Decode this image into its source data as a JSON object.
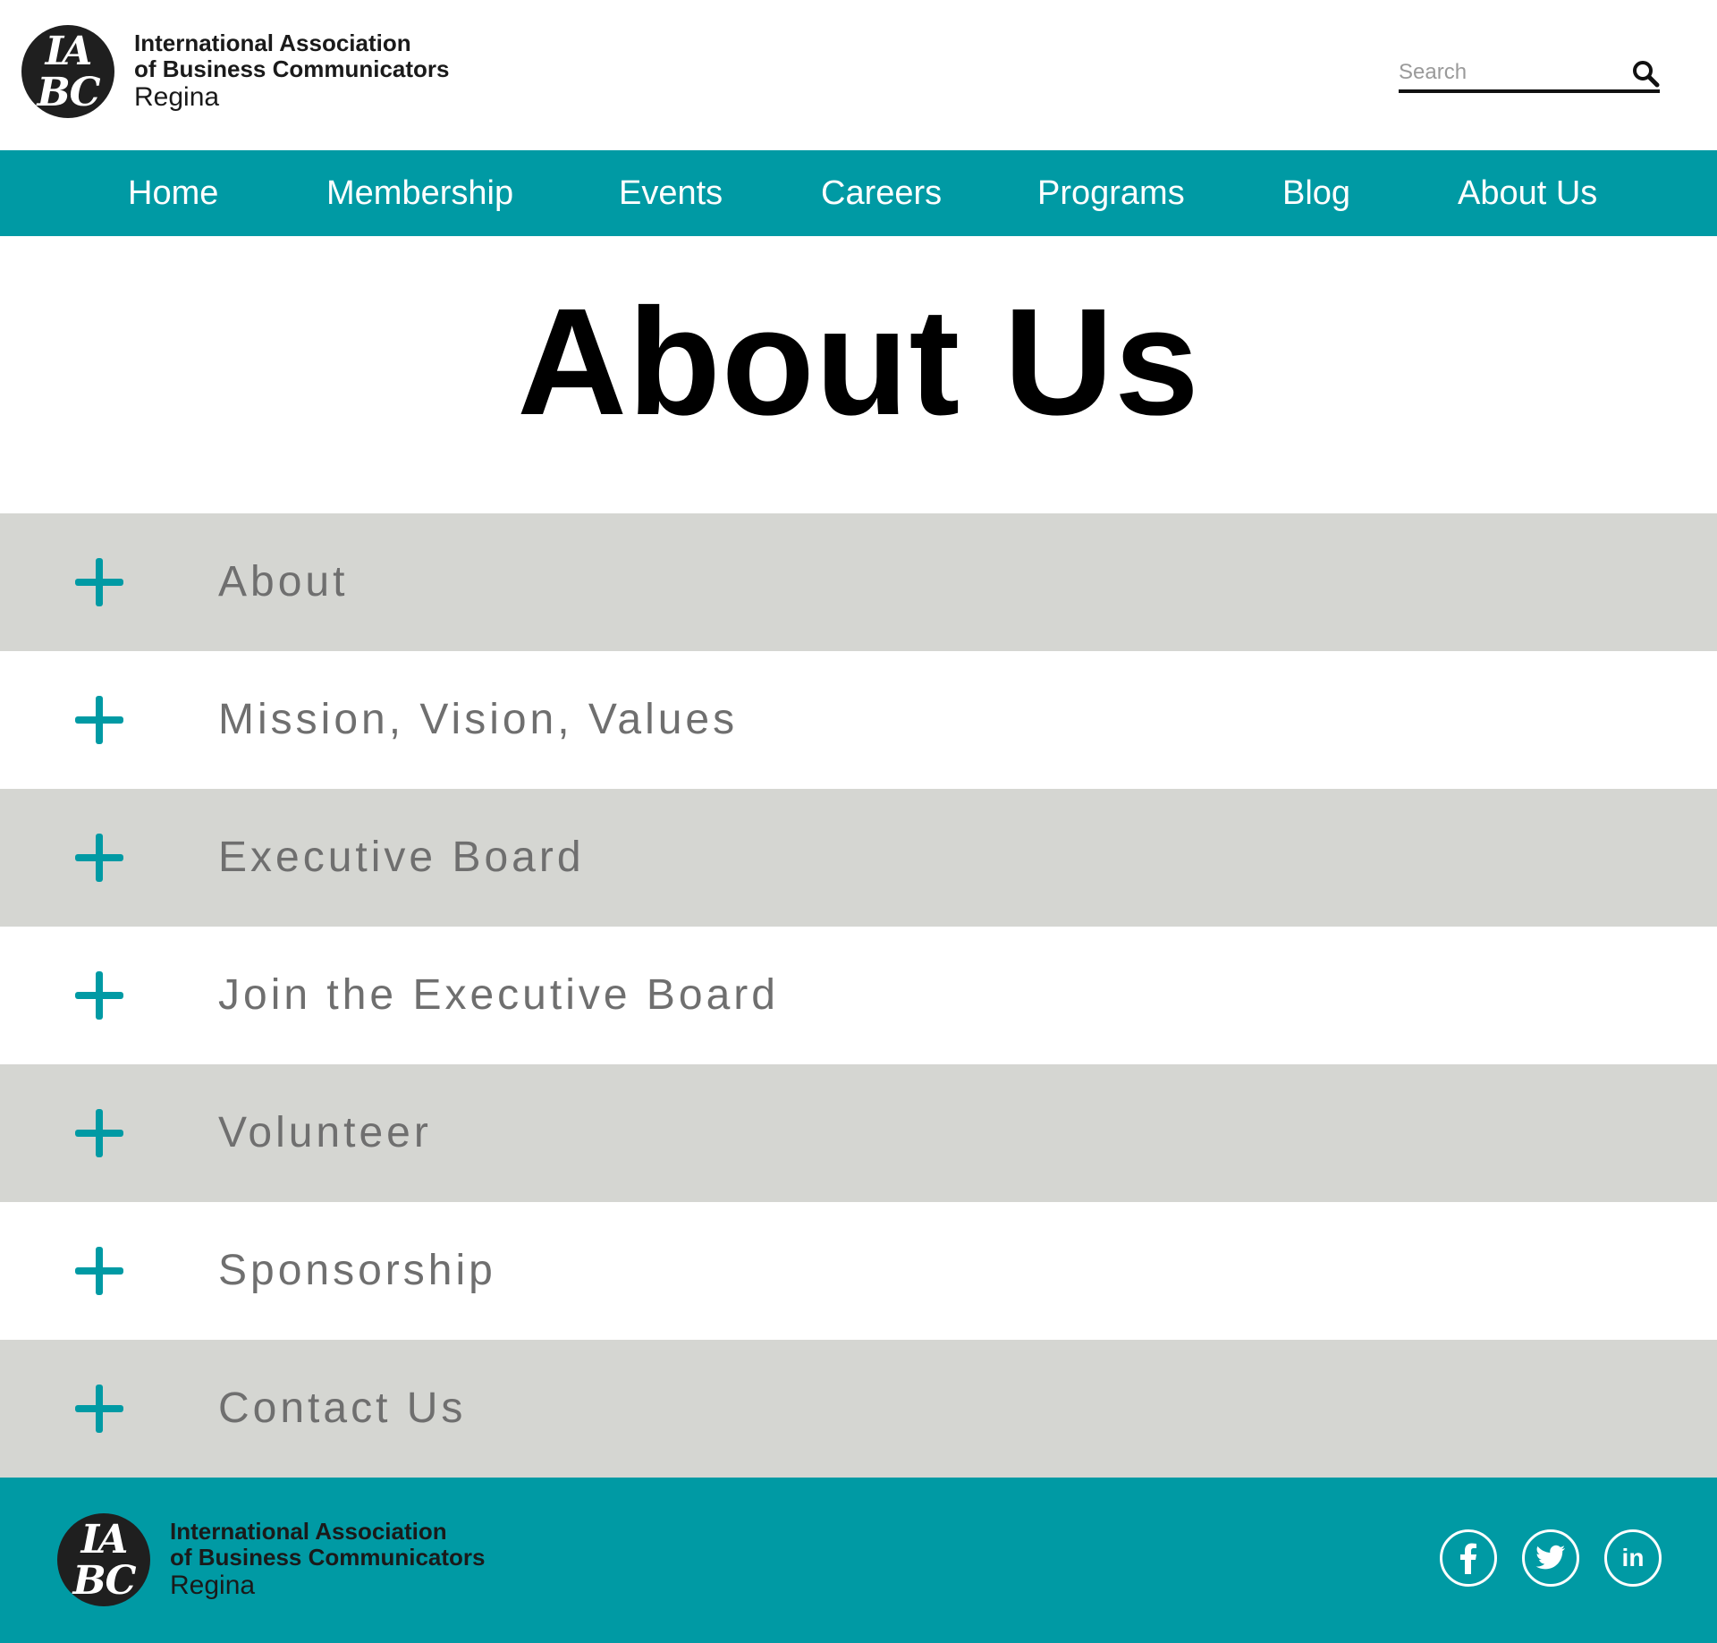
{
  "brand": {
    "logo_mark_top": "IA",
    "logo_mark_bottom": "BC",
    "line1": "International Association",
    "line2": "of Business Communicators",
    "line3": "Regina"
  },
  "search": {
    "placeholder": "Search",
    "icon": "search-icon"
  },
  "nav": {
    "items": [
      {
        "label": "Home"
      },
      {
        "label": "Membership"
      },
      {
        "label": "Events"
      },
      {
        "label": "Careers"
      },
      {
        "label": "Programs"
      },
      {
        "label": "Blog"
      },
      {
        "label": "About Us"
      }
    ]
  },
  "page": {
    "title": "About Us"
  },
  "accordion": {
    "items": [
      {
        "label": "About"
      },
      {
        "label": "Mission, Vision, Values"
      },
      {
        "label": "Executive Board"
      },
      {
        "label": "Join the Executive Board"
      },
      {
        "label": "Volunteer"
      },
      {
        "label": "Sponsorship"
      },
      {
        "label": "Contact Us"
      }
    ]
  },
  "footer": {
    "socials": [
      {
        "icon": "facebook-icon"
      },
      {
        "icon": "twitter-icon"
      },
      {
        "icon": "linkedin-icon",
        "text": "in"
      }
    ]
  },
  "colors": {
    "accent": "#009aa4",
    "shaded_row": "#d5d6d2",
    "label_text": "#6f6f6f"
  }
}
